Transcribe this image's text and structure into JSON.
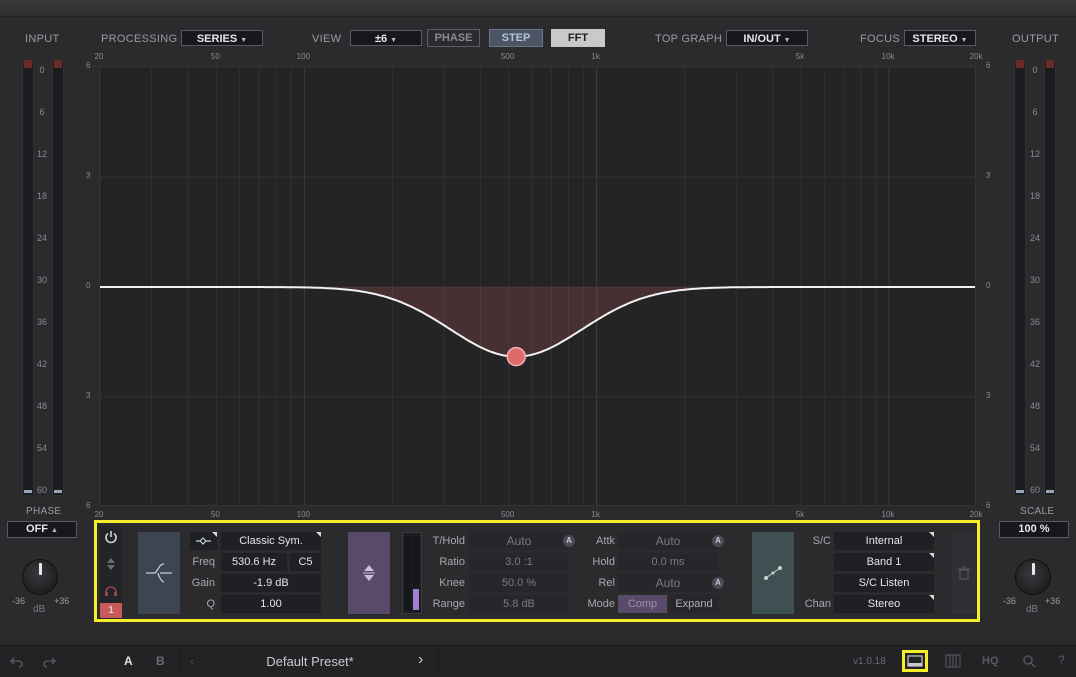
{
  "header": {
    "input_label": "INPUT",
    "output_label": "OUTPUT",
    "processing_label": "PROCESSING",
    "processing_value": "SERIES",
    "view_label": "VIEW",
    "view_range": "±6",
    "phase_btn": "PHASE",
    "step_btn": "STEP",
    "fft_btn": "FFT",
    "topgraph_label": "TOP GRAPH",
    "topgraph_value": "IN/OUT",
    "focus_label": "FOCUS",
    "focus_value": "STEREO"
  },
  "freq_labels_top": [
    "20",
    "50",
    "100",
    "500",
    "1k",
    "5k",
    "10k",
    "20k"
  ],
  "freq_labels_bottom": [
    "20",
    "50",
    "100",
    "500",
    "1k",
    "5k",
    "10k",
    "20k"
  ],
  "db_labels": [
    "6",
    "3",
    "0",
    "3",
    "6"
  ],
  "meter_scale": [
    "0",
    "6",
    "12",
    "18",
    "24",
    "30",
    "36",
    "42",
    "48",
    "54",
    "60"
  ],
  "left": {
    "phase_label": "PHASE",
    "phase_value": "OFF",
    "knob_min": "-36",
    "knob_max": "+36",
    "knob_unit": "dB"
  },
  "right": {
    "scale_label": "SCALE",
    "scale_value": "100 %",
    "knob_min": "-36",
    "knob_max": "+36",
    "knob_unit": "dB"
  },
  "band": {
    "number": "1",
    "shape": "Classic Sym.",
    "freq_label": "Freq",
    "freq_value": "530.6 Hz",
    "note": "C5",
    "gain_label": "Gain",
    "gain_value": "-1.9 dB",
    "q_label": "Q",
    "q_value": "1.00",
    "thold_label": "T/Hold",
    "thold_value": "Auto",
    "ratio_label": "Ratio",
    "ratio_value": "3.0 :1",
    "knee_label": "Knee",
    "knee_value": "50.0 %",
    "range_label": "Range",
    "range_value": "5.8 dB",
    "attk_label": "Attk",
    "attk_value": "Auto",
    "hold_label": "Hold",
    "hold_value": "0.0 ms",
    "rel_label": "Rel",
    "rel_value": "Auto",
    "mode_label": "Mode",
    "mode_comp": "Comp",
    "mode_expand": "Expand",
    "auto_badge": "A",
    "sc_label": "S/C",
    "sc_value": "Internal",
    "sc_band": "Band 1",
    "sc_listen": "S/C Listen",
    "chan_label": "Chan",
    "chan_value": "Stereo"
  },
  "footer": {
    "a_label": "A",
    "b_label": "B",
    "preset_name": "Default Preset*",
    "version": "v1.0.18",
    "hq_label": "HQ"
  },
  "colors": {
    "accent_pink": "#e06a6a",
    "highlight_yellow": "#f5ee2a",
    "dynamics_purple": "#a080c8"
  }
}
